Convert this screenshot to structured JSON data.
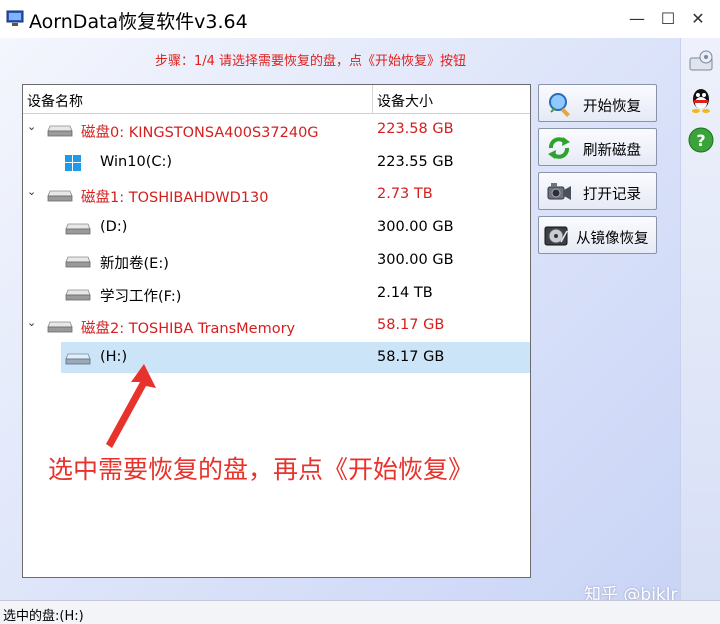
{
  "window": {
    "title": "AornData恢复软件v3.64"
  },
  "titlebar_buttons": {
    "minimize": "—",
    "maximize": "☐",
    "close": "✕"
  },
  "step_text": "步骤：1/4 请选择需要恢复的盘，点《开始恢复》按钮",
  "table": {
    "col_name": "设备名称",
    "col_size": "设备大小",
    "rows": [
      {
        "name": "磁盘0: KINGSTONSA400S37240G",
        "size": "223.58 GB",
        "type": "disk"
      },
      {
        "name": "Win10(C:)",
        "size": "223.55 GB",
        "type": "partition-windows"
      },
      {
        "name": "磁盘1: TOSHIBAHDWD130",
        "size": "2.73 TB",
        "type": "disk"
      },
      {
        "name": "(D:)",
        "size": "300.00 GB",
        "type": "partition"
      },
      {
        "name": "新加卷(E:)",
        "size": "300.00 GB",
        "type": "partition"
      },
      {
        "name": "学习工作(F:)",
        "size": "2.14 TB",
        "type": "partition"
      },
      {
        "name": "磁盘2: TOSHIBA  TransMemory",
        "size": "58.17 GB",
        "type": "disk"
      },
      {
        "name": "(H:)",
        "size": "58.17 GB",
        "type": "partition",
        "selected": true
      }
    ]
  },
  "buttons": {
    "start_recovery": "开始恢复",
    "refresh_disk": "刷新磁盘",
    "open_record": "打开记录",
    "image_recovery": "从镜像恢复"
  },
  "annotation": "选中需要恢复的盘，再点《开始恢复》",
  "watermark": "知乎 @bjklr",
  "status": "选中的盘:(H:)",
  "colors": {
    "accent_red": "#d41f1f",
    "selection": "#cce4f7",
    "annotation_red": "#e8322c"
  }
}
